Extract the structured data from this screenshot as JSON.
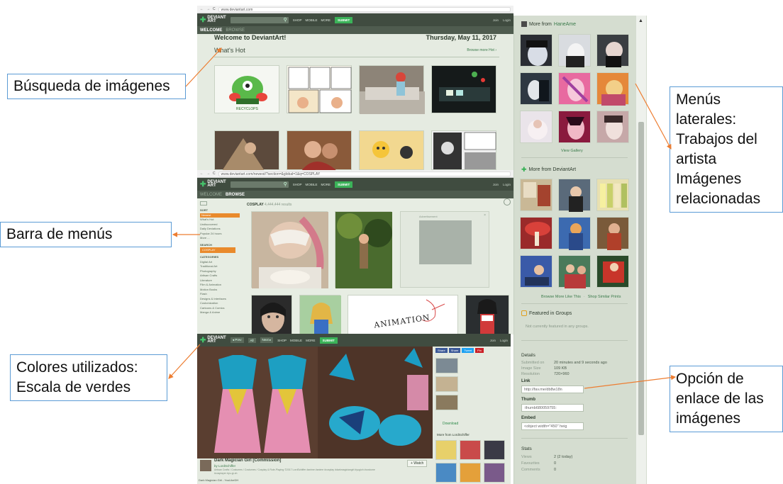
{
  "callouts": {
    "busqueda": "Búsqueda de imágenes",
    "barra": "Barra de menús",
    "colores_l1": "Colores utilizados:",
    "colores_l2": "Escala de verdes",
    "menus_l1": "Menús",
    "menus_l2": "laterales:",
    "menus_l3": "Trabajos del",
    "menus_l4": "artista",
    "menus_l5": "Imágenes",
    "menus_l6": "relacionadas",
    "opcion_l1": "Opción de",
    "opcion_l2": "enlace de las",
    "opcion_l3": "imágenes"
  },
  "colors": {
    "callout_border": "#5b9bd5",
    "leader": "#ed7d31",
    "header": "#404c40",
    "accent": "#3bb359",
    "orange": "#e98a2c"
  },
  "shot1": {
    "url": "www.deviantart.com",
    "logo_l1": "DEVIANT",
    "logo_l2": "ART",
    "nav": [
      "SHOP",
      "MOBILE",
      "MORE"
    ],
    "submit": "SUBMIT",
    "user": [
      "Join",
      "Login"
    ],
    "tab_welcome": "WELCOME",
    "tab_browse": "BROWSE",
    "welcome_title": "Welcome to DeviantArt!",
    "date": "Thursday, May 11, 2017",
    "hot_title": "What's Hot",
    "browse_more": "Browse more Hot ›",
    "thumb_caption": "RECYCLOPS"
  },
  "shot2": {
    "url": "www.deviantart.com/newest/?section=&global=1&q=COSPLAY",
    "logo_l1": "DEVIANT",
    "logo_l2": "ART",
    "nav": [
      "SHOP",
      "MOBILE",
      "MORE"
    ],
    "submit": "SUBMIT",
    "user": [
      "Join",
      "Login"
    ],
    "tab_welcome": "WELCOME",
    "tab_browse": "BROWSE",
    "sort_head": "SORT",
    "sort_items": [
      "Newest",
      "What's Hot",
      "Undiscovered",
      "Daily Deviations",
      "Popular 24 hours",
      "More ..."
    ],
    "search_head": "SEARCH",
    "search_value": "COSPLAY",
    "cat_head": "CATEGORIES",
    "categories": [
      "Digital Art",
      "Traditional Art",
      "Photography",
      "Artisan Crafts",
      "Literature",
      "Film & Animation",
      "Motion Books",
      "Flash",
      "Designs & Interfaces",
      "Customization",
      "Cartoons & Comics",
      "Manga & Anime"
    ],
    "results_label": "COSPLAY",
    "results_count": "4,444,444 results",
    "ad_label": "Advertisement",
    "animation_text": "ANIMATION"
  },
  "shot3": {
    "logo_l1": "DEVIANT",
    "logo_l2": "ART",
    "nav_btns": [
      "◂ Prev",
      "All",
      "Next ▸"
    ],
    "nav": [
      "SHOP",
      "MOBILE",
      "MORE"
    ],
    "submit": "SUBMIT",
    "user": [
      "Join",
      "Login"
    ],
    "share": [
      "Share",
      "Share",
      "Tweet",
      "Pin"
    ],
    "title": "Dark Magician Girl [Commission]",
    "by": "by LordSchiffer",
    "tags": "Artisan Crafts / Costumes / Costumes / Cosplay & Role-Playing  ©2017 LordSchiffer  #anime #anime #cosplay #darkmagiciangirl #yugioh #costume #cosplayer #yu-gi-oh",
    "watch": "+ Watch",
    "download": "Download",
    "more_from": "More from LordSchiffer",
    "footer": "Dark Magician Girl - YouLikeDH"
  },
  "sidebar": {
    "more_from_label": "More from",
    "artist": "HaneAme",
    "view_gallery": "View Gallery",
    "more_da": "More from DeviantArt",
    "browse_more": "Browse More Like This",
    "shop_similar": "Shop Similar Prints",
    "sep": "·",
    "featured": "Featured in Groups",
    "not_featured": "Not currently featured in any groups.",
    "details": "Details",
    "submitted_k": "Submitted on",
    "submitted_v": "20 minutes and 9 seconds ago",
    "size_k": "Image Size",
    "size_v": "109 KB",
    "res_k": "Resolution",
    "res_v": "720×960",
    "link_label": "Link",
    "link_value": "http://fav.me/db8w18n",
    "thumb_label": "Thumb",
    "thumb_value": ":thumb680059755:",
    "embed_label": "Embed",
    "embed_value": "<object width=\"450\" heig",
    "stats": "Stats",
    "views_k": "Views",
    "views_v": "2 (2 today)",
    "fav_k": "Favourites",
    "fav_v": "0",
    "com_k": "Comments",
    "com_v": "0"
  }
}
